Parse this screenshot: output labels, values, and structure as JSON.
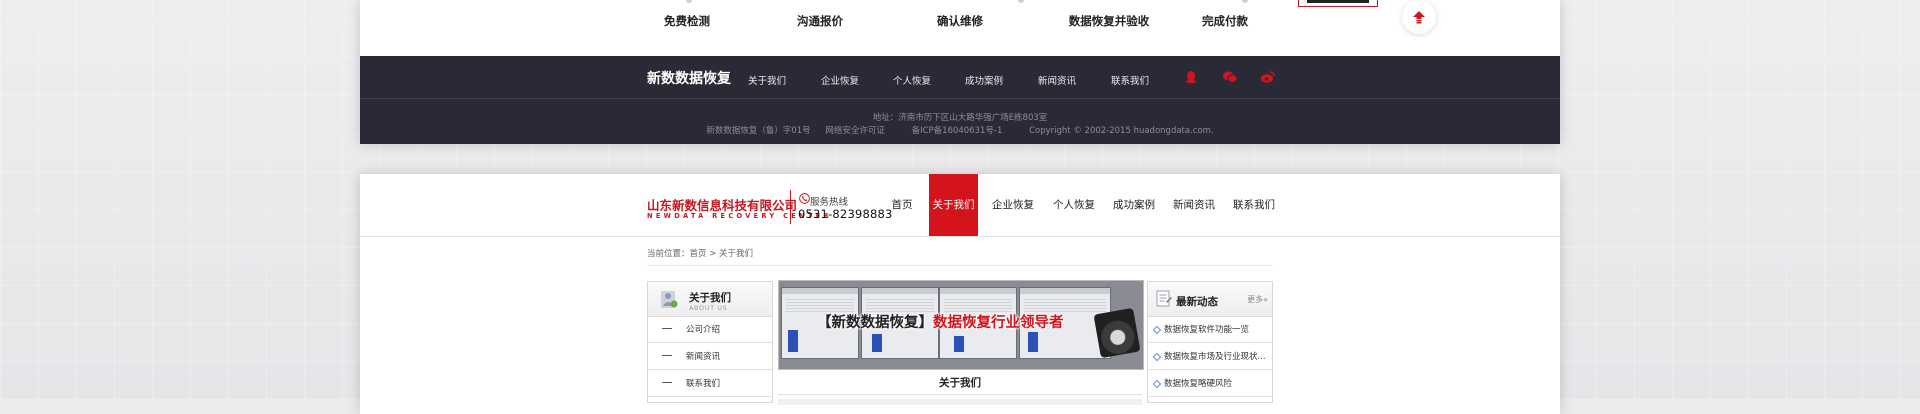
{
  "process_steps": [
    "免费检测",
    "沟通报价",
    "确认维修",
    "数据恢复并验收",
    "完成付款"
  ],
  "back_to_top_icon": "arrow-up-icon",
  "footer": {
    "brand": "新数数据恢复",
    "links": [
      "关于我们",
      "企业恢复",
      "个人恢复",
      "成功案例",
      "新闻资讯",
      "联系我们"
    ],
    "social_icons": [
      "qq-icon",
      "wechat-icon",
      "weibo-icon"
    ],
    "address": "地址：济南市历下区山大路华强广场E栋803室",
    "record_line": [
      "新数数据恢复（鲁）字01号",
      "网络安全许可证",
      "备ICP备16040631号-1",
      "Copyright © 2002-2015 huadongdata.com."
    ]
  },
  "header": {
    "company_name": "山东新数信息科技有限公司",
    "company_en": "NEWDATA RECOVERY CENTER",
    "hotline_label": "服务热线",
    "hotline_number": "0531-82398883",
    "nav": [
      "首页",
      "关于我们",
      "企业恢复",
      "个人恢复",
      "成功案例",
      "新闻资讯",
      "联系我们"
    ],
    "active_nav": "关于我们"
  },
  "breadcrumb": "当前位置：首页 > 关于我们",
  "sidebar": {
    "title": "关于我们",
    "subtitle": "ABOUT US",
    "items": [
      "公司介绍",
      "新闻资讯",
      "联系我们"
    ]
  },
  "banner": {
    "text_black": "【新数数据恢复】",
    "text_red": "数据恢复行业领导者"
  },
  "content_title": "关于我们",
  "news": {
    "title": "最新动态",
    "more": "更多»",
    "items": [
      "数据恢复软件功能一览",
      "数据恢复市场及行业现状...",
      "数据恢复略硬风险"
    ]
  },
  "colors": {
    "brand_red": "#d4141c",
    "footer_bg": "#2a2a37"
  }
}
